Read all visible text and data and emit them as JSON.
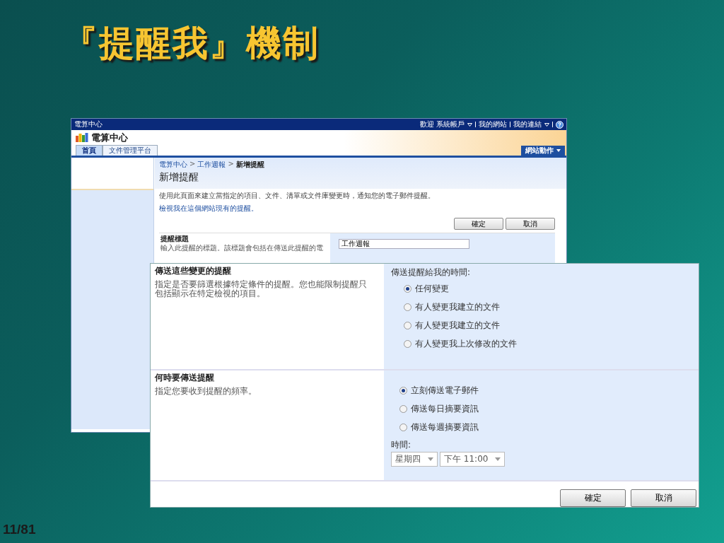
{
  "slide": {
    "title": "『提醒我』機制",
    "page_number": "11/81"
  },
  "back_screenshot": {
    "top_bar": {
      "site": "電算中心",
      "welcome": "歡迎 系統帳戶",
      "links": [
        "我的網站",
        "我的連結"
      ]
    },
    "site_title": "電算中心",
    "tabs": [
      {
        "label": "首頁",
        "selected": true
      },
      {
        "label": "文件管理平台",
        "selected": false
      }
    ],
    "site_actions": "網站動作",
    "breadcrumb": [
      "電算中心",
      "工作週報",
      "新增提醒"
    ],
    "breadcrumb_separator": ">",
    "page_title": "新增提醒",
    "description": "使用此頁面來建立當指定的項目、文件、清單或文件庫變更時，通知您的電子郵件提醒。",
    "view_link": "檢視我在這個網站現有的提醒。",
    "buttons": [
      "確定",
      "取消"
    ],
    "alert_title_field": {
      "label": "提醒標題",
      "description": "輸入此提醒的標題。該標題會包括在傳送此提醒的電",
      "value": "工作週報"
    }
  },
  "front_panel": {
    "sections": [
      {
        "title": "傳送這些變更的提醒",
        "description": "指定是否要篩選根據特定條件的提醒。您也能限制提醒只包括顯示在特定檢視的項目。",
        "prompt": "傳送提醒給我的時間:",
        "options": [
          {
            "label": "任何變更",
            "selected": true
          },
          {
            "label": "有人變更我建立的文件",
            "selected": false
          },
          {
            "label": "有人變更我建立的文件",
            "selected": false
          },
          {
            "label": "有人變更我上次修改的文件",
            "selected": false
          }
        ]
      },
      {
        "title": "何時要傳送提醒",
        "description": "指定您要收到提醒的頻率。",
        "options": [
          {
            "label": "立刻傳送電子郵件",
            "selected": true
          },
          {
            "label": "傳送每日摘要資訊",
            "selected": false
          },
          {
            "label": "傳送每週摘要資訊",
            "selected": false
          }
        ],
        "time_label": "時間:",
        "day": "星期四",
        "time": "下午 11:00"
      }
    ],
    "buttons": [
      "確定",
      "取消"
    ]
  }
}
